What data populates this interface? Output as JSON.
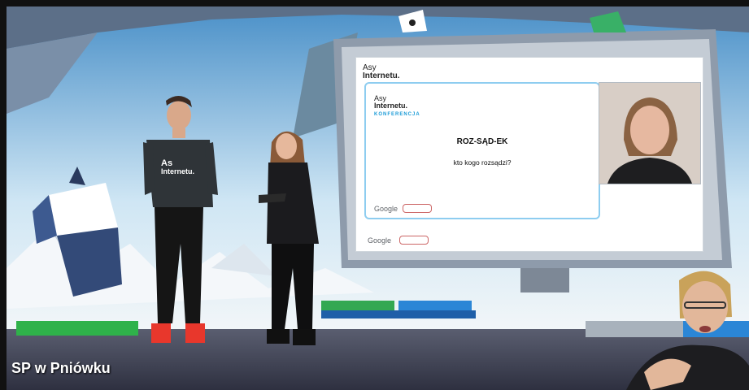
{
  "broadcast": {
    "caption": "SP w Pniówku"
  },
  "screen": {
    "header_line1": "Asy",
    "header_line2": "Internetu.",
    "slide": {
      "logo_line1": "Asy",
      "logo_line2": "Internetu.",
      "logo_line3": "KONFERENCJA",
      "title": "ROZ-SĄD-EK",
      "subtitle": "kto kogo rozsądzi?"
    },
    "google_label": "Google"
  },
  "presenter_shirt_text": "As Internetu."
}
